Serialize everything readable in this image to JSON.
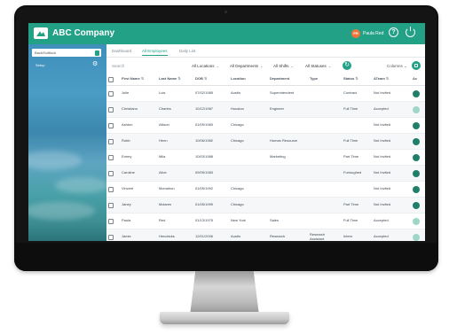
{
  "app": {
    "company": "ABC Company"
  },
  "header": {
    "avatar_initials": "PR",
    "user_name": "Paula Red",
    "help_icon": "help-icon",
    "power_icon": "power-icon"
  },
  "sidebar": {
    "search_value": "Back/Softluck",
    "setup_label": "Setup"
  },
  "tabs": [
    {
      "label": "Dashboard"
    },
    {
      "label": "All Employees"
    },
    {
      "label": "Daily List"
    }
  ],
  "filters": {
    "search_placeholder": "Search",
    "locations": "All Locations",
    "departments": "All Departments",
    "shifts": "All Shifts",
    "statuses": "All Statuses",
    "columns": "Columns"
  },
  "table": {
    "headers": [
      "First Name",
      "Last Name",
      "DOB",
      "Location",
      "Department",
      "Type",
      "Status",
      "ATeam",
      "Ac"
    ],
    "rows": [
      {
        "first": "Julie",
        "last": "Luis",
        "dob": "07/02/1985",
        "location": "Austin",
        "department": "Superintendent",
        "type": "",
        "status": "Contract",
        "ateam": "Not Invited"
      },
      {
        "first": "Christiano",
        "last": "Charles",
        "dob": "10/12/1987",
        "location": "Houston",
        "department": "Engineer",
        "type": "",
        "status": "Full Time",
        "ateam": "Accepted"
      },
      {
        "first": "Ashton",
        "last": "Allison",
        "dob": "01/09/1983",
        "location": "Chicago",
        "department": "",
        "type": "",
        "status": "",
        "ateam": "Not Invited"
      },
      {
        "first": "Robb",
        "last": "Henn",
        "dob": "10/06/1982",
        "location": "Chicago",
        "department": "Human Resource",
        "type": "",
        "status": "Full Time",
        "ateam": "Not Invited"
      },
      {
        "first": "Emmy",
        "last": "Mila",
        "dob": "10/03/1988",
        "location": "",
        "department": "Marketing",
        "type": "",
        "status": "Part Time",
        "ateam": "Not Invited"
      },
      {
        "first": "Caroline",
        "last": "Alice",
        "dob": "09/05/1983",
        "location": "",
        "department": "",
        "type": "",
        "status": "Furloughed",
        "ateam": "Not Invited"
      },
      {
        "first": "Vincent",
        "last": "Mcmahon",
        "dob": "01/05/1992",
        "location": "Chicago",
        "department": "",
        "type": "",
        "status": "",
        "ateam": "Not Invited"
      },
      {
        "first": "Janey",
        "last": "Mclaren",
        "dob": "01/05/1999",
        "location": "Chicago",
        "department": "",
        "type": "",
        "status": "Part Time",
        "ateam": "Not Invited"
      },
      {
        "first": "Paula",
        "last": "Red",
        "dob": "01/13/1975",
        "location": "New York",
        "department": "Sales",
        "type": "",
        "status": "Full Time",
        "ateam": "Accepted"
      },
      {
        "first": "Jamie",
        "last": "Hendricks",
        "dob": "12/01/2006",
        "location": "Austin",
        "department": "Research",
        "type": "Research Assistant",
        "status": "Intern",
        "ateam": "Accepted"
      }
    ]
  }
}
